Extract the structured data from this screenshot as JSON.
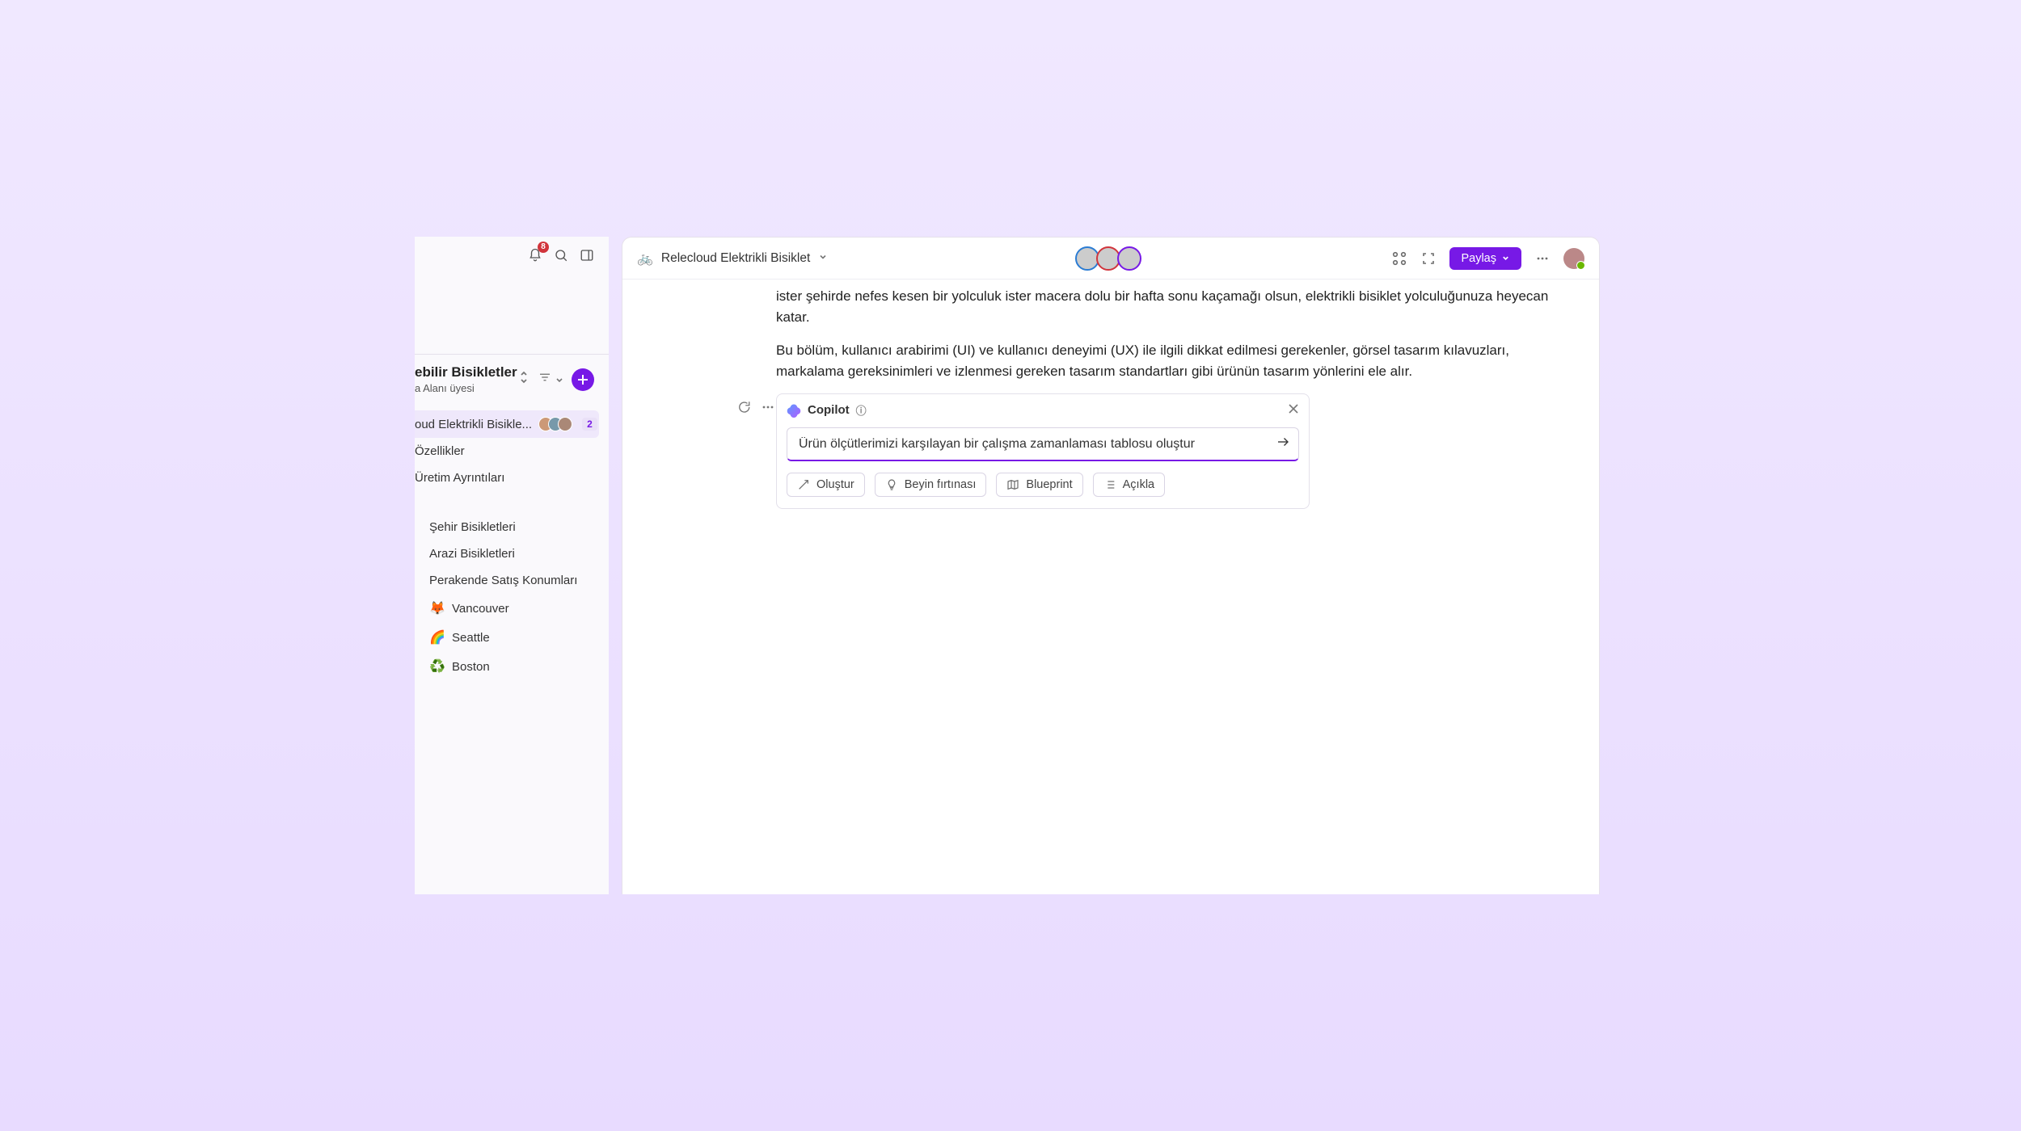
{
  "sidebar": {
    "notification_count": "8",
    "workspace_title": "ebilir Bisikletler",
    "workspace_subtitle": "a Alanı üyesi",
    "items": [
      {
        "label": "oud Elektrikli Bisikle...",
        "badge": "2"
      },
      {
        "label": "Özellikler"
      },
      {
        "label": "Üretim Ayrıntıları"
      }
    ],
    "items2": [
      {
        "label": "Şehir Bisikletleri"
      },
      {
        "label": "Arazi Bisikletleri"
      },
      {
        "label": "Perakende Satış Konumları"
      },
      {
        "label": "Vancouver",
        "emoji": "🦊"
      },
      {
        "label": "Seattle",
        "emoji": "🌈"
      },
      {
        "label": "Boston",
        "emoji": "♻️"
      }
    ]
  },
  "topbar": {
    "doc_emoji": "🚲",
    "doc_title": "Relecloud Elektrikli Bisiklet",
    "share_label": "Paylaş"
  },
  "content": {
    "para1": "ister şehirde nefes kesen bir yolculuk ister macera dolu bir hafta sonu kaçamağı olsun, elektrikli bisiklet yolculuğunuza heyecan katar.",
    "para2": "Bu bölüm, kullanıcı arabirimi (UI) ve kullanıcı deneyimi (UX) ile ilgili dikkat edilmesi gerekenler, görsel tasarım kılavuzları, markalama gereksinimleri ve izlenmesi gereken tasarım standartları gibi ürünün tasarım yönlerini ele alır."
  },
  "copilot": {
    "title": "Copilot",
    "input_value": "Ürün ölçütlerimizi karşılayan bir çalışma zamanlaması tablosu oluştur",
    "chips": [
      {
        "label": "Oluştur"
      },
      {
        "label": "Beyin fırtınası"
      },
      {
        "label": "Blueprint"
      },
      {
        "label": "Açıkla"
      }
    ]
  }
}
